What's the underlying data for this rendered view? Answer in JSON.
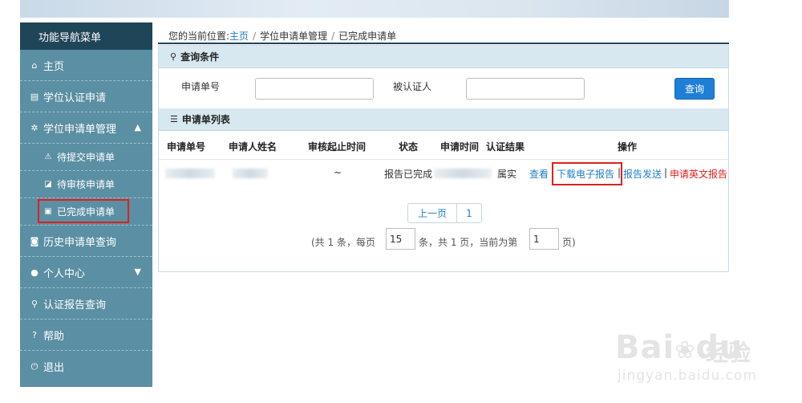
{
  "sidebar": {
    "title": "功能导航菜单",
    "items": [
      {
        "label": "主页",
        "icon": "home-icon"
      },
      {
        "label": "学位认证申请",
        "icon": "document-icon"
      },
      {
        "label": "学位申请单管理",
        "icon": "gear-icon"
      },
      {
        "label": "待提交申请单",
        "icon": "warning-icon"
      },
      {
        "label": "待审核申请单",
        "icon": "cart-icon"
      },
      {
        "label": "已完成申请单",
        "icon": "briefcase-icon"
      },
      {
        "label": "历史申请单查询",
        "icon": "camera-icon"
      },
      {
        "label": "个人中心",
        "icon": "user-icon"
      },
      {
        "label": "认证报告查询",
        "icon": "search-icon"
      },
      {
        "label": "帮助",
        "icon": "help-icon"
      },
      {
        "label": "退出",
        "icon": "power-icon"
      }
    ]
  },
  "breadcrumb": {
    "prefix": "您的当前位置:",
    "home": "主页",
    "level2": "学位申请单管理",
    "level3": "已完成申请单"
  },
  "query": {
    "title": "查询条件",
    "field1_label": "申请单号",
    "field2_label": "被认证人",
    "button": "查询"
  },
  "list": {
    "title": "申请单列表",
    "columns": [
      "申请单号",
      "申请人姓名",
      "审核起止时间",
      "状态",
      "申请时间",
      "认证结果",
      "操作"
    ],
    "row": {
      "time_range": "~",
      "status": "报告已完成",
      "result": "属实",
      "actions": [
        "查看",
        "下载电子报告",
        "报告发送",
        "申请英文报告"
      ]
    }
  },
  "pagination": {
    "prev": "上一页",
    "page": "1",
    "info_prefix": "(共 1 条，每页",
    "per_page": "15",
    "info_mid": "条，共 1 页，当前为第",
    "current": "1",
    "info_suffix": "页)"
  },
  "watermark": {
    "brand": "Bai",
    "brand2": "du",
    "tag": "经验",
    "url": "jingyan.baidu.com"
  },
  "colors": {
    "sidebar": "#5b8fa3",
    "sidebar_head": "#1f4558",
    "link": "#1f7fc3",
    "highlight": "#e0201c",
    "button": "#1f7fd6"
  }
}
